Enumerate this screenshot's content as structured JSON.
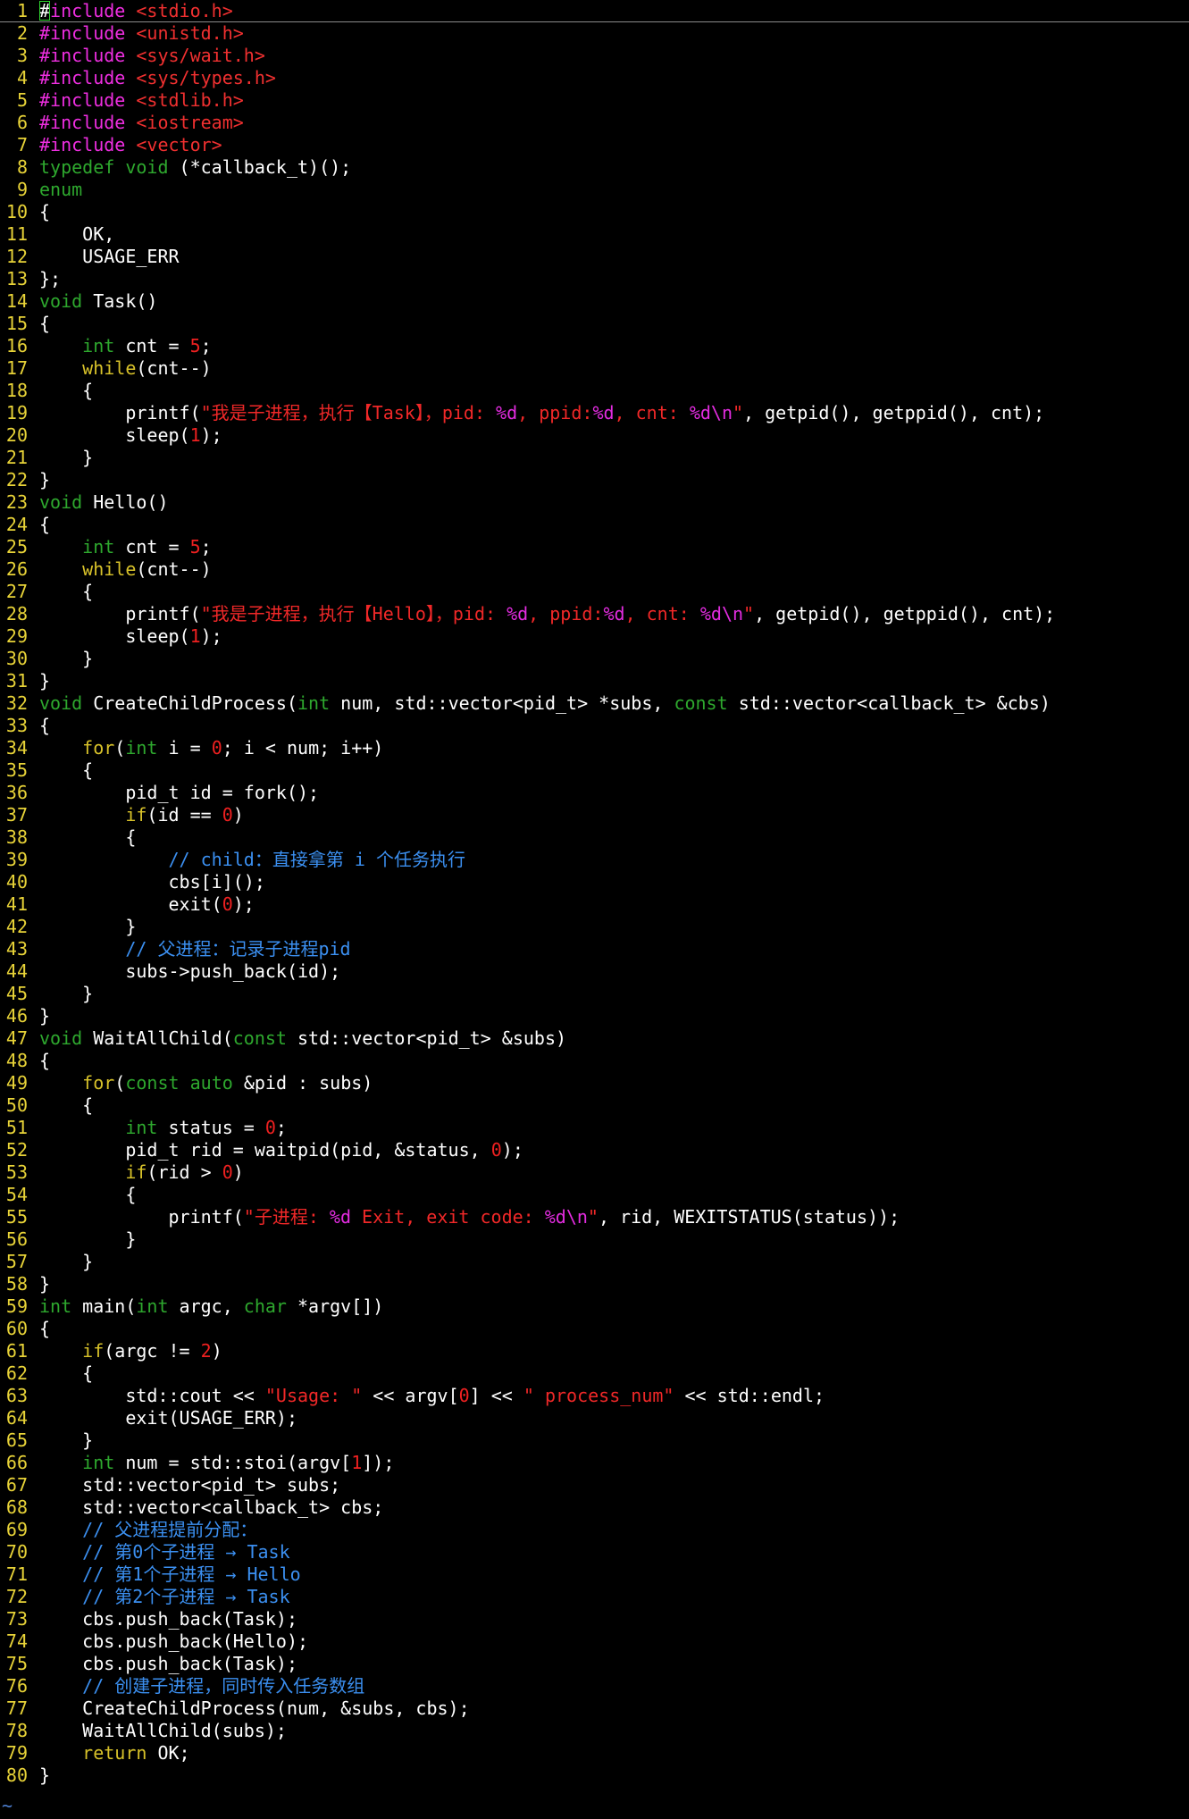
{
  "editor": {
    "colors": {
      "background": "#000000",
      "line_number": "#e8d338",
      "text": "#ffffff",
      "preprocessor": "#ee2ee0",
      "header": "#f03030",
      "type": "#2ea82e",
      "keyword": "#d8c22a",
      "number": "#ee2020",
      "string": "#f02828",
      "format": "#e32ce0",
      "comment": "#3b8ff0",
      "cursor": "#2fd52f"
    },
    "cursor_line": 1,
    "empty_marker": "~",
    "lines": [
      {
        "n": "1",
        "tokens": [
          [
            "t",
            "#"
          ],
          [
            "p",
            "include "
          ],
          [
            "h",
            "<stdio.h>"
          ]
        ]
      },
      {
        "n": "2",
        "tokens": [
          [
            "p",
            "#include "
          ],
          [
            "h",
            "<unistd.h>"
          ]
        ]
      },
      {
        "n": "3",
        "tokens": [
          [
            "p",
            "#include "
          ],
          [
            "h",
            "<sys/wait.h>"
          ]
        ]
      },
      {
        "n": "4",
        "tokens": [
          [
            "p",
            "#include "
          ],
          [
            "h",
            "<sys/types.h>"
          ]
        ]
      },
      {
        "n": "5",
        "tokens": [
          [
            "p",
            "#include "
          ],
          [
            "h",
            "<stdlib.h>"
          ]
        ]
      },
      {
        "n": "6",
        "tokens": [
          [
            "p",
            "#include "
          ],
          [
            "h",
            "<iostream>"
          ]
        ]
      },
      {
        "n": "7",
        "tokens": [
          [
            "p",
            "#include "
          ],
          [
            "h",
            "<vector>"
          ]
        ]
      },
      {
        "n": "8",
        "tokens": [
          [
            "y",
            "typedef"
          ],
          [
            "t",
            " "
          ],
          [
            "y",
            "void"
          ],
          [
            "t",
            " (*callback_t)();"
          ]
        ]
      },
      {
        "n": "9",
        "tokens": [
          [
            "y",
            "enum"
          ]
        ]
      },
      {
        "n": "10",
        "tokens": [
          [
            "t",
            "{"
          ]
        ]
      },
      {
        "n": "11",
        "tokens": [
          [
            "t",
            "    OK,"
          ]
        ]
      },
      {
        "n": "12",
        "tokens": [
          [
            "t",
            "    USAGE_ERR"
          ]
        ]
      },
      {
        "n": "13",
        "tokens": [
          [
            "t",
            "};"
          ]
        ]
      },
      {
        "n": "14",
        "tokens": [
          [
            "y",
            "void"
          ],
          [
            "t",
            " Task()"
          ]
        ]
      },
      {
        "n": "15",
        "tokens": [
          [
            "t",
            "{"
          ]
        ]
      },
      {
        "n": "16",
        "tokens": [
          [
            "t",
            "    "
          ],
          [
            "y",
            "int"
          ],
          [
            "t",
            " cnt = "
          ],
          [
            "d",
            "5"
          ],
          [
            "t",
            ";"
          ]
        ]
      },
      {
        "n": "17",
        "tokens": [
          [
            "t",
            "    "
          ],
          [
            "k",
            "while"
          ],
          [
            "t",
            "(cnt--)"
          ]
        ]
      },
      {
        "n": "18",
        "tokens": [
          [
            "t",
            "    {"
          ]
        ]
      },
      {
        "n": "19",
        "tokens": [
          [
            "t",
            "        printf("
          ],
          [
            "s",
            "\"我是子进程，执行【Task】，pid: "
          ],
          [
            "f",
            "%d"
          ],
          [
            "s",
            ", ppid:"
          ],
          [
            "f",
            "%d"
          ],
          [
            "s",
            ", cnt: "
          ],
          [
            "f",
            "%d\\n"
          ],
          [
            "s",
            "\""
          ],
          [
            "t",
            ", getpid(), getppid(), cnt);"
          ]
        ]
      },
      {
        "n": "20",
        "tokens": [
          [
            "t",
            "        sleep("
          ],
          [
            "d",
            "1"
          ],
          [
            "t",
            ");"
          ]
        ]
      },
      {
        "n": "21",
        "tokens": [
          [
            "t",
            "    }"
          ]
        ]
      },
      {
        "n": "22",
        "tokens": [
          [
            "t",
            "}"
          ]
        ]
      },
      {
        "n": "23",
        "tokens": [
          [
            "y",
            "void"
          ],
          [
            "t",
            " Hello()"
          ]
        ]
      },
      {
        "n": "24",
        "tokens": [
          [
            "t",
            "{"
          ]
        ]
      },
      {
        "n": "25",
        "tokens": [
          [
            "t",
            "    "
          ],
          [
            "y",
            "int"
          ],
          [
            "t",
            " cnt = "
          ],
          [
            "d",
            "5"
          ],
          [
            "t",
            ";"
          ]
        ]
      },
      {
        "n": "26",
        "tokens": [
          [
            "t",
            "    "
          ],
          [
            "k",
            "while"
          ],
          [
            "t",
            "(cnt--)"
          ]
        ]
      },
      {
        "n": "27",
        "tokens": [
          [
            "t",
            "    {"
          ]
        ]
      },
      {
        "n": "28",
        "tokens": [
          [
            "t",
            "        printf("
          ],
          [
            "s",
            "\"我是子进程，执行【Hello】，pid: "
          ],
          [
            "f",
            "%d"
          ],
          [
            "s",
            ", ppid:"
          ],
          [
            "f",
            "%d"
          ],
          [
            "s",
            ", cnt: "
          ],
          [
            "f",
            "%d\\n"
          ],
          [
            "s",
            "\""
          ],
          [
            "t",
            ", getpid(), getppid(), cnt);"
          ]
        ]
      },
      {
        "n": "29",
        "tokens": [
          [
            "t",
            "        sleep("
          ],
          [
            "d",
            "1"
          ],
          [
            "t",
            ");"
          ]
        ]
      },
      {
        "n": "30",
        "tokens": [
          [
            "t",
            "    }"
          ]
        ]
      },
      {
        "n": "31",
        "tokens": [
          [
            "t",
            "}"
          ]
        ]
      },
      {
        "n": "32",
        "tokens": [
          [
            "y",
            "void"
          ],
          [
            "t",
            " CreateChildProcess("
          ],
          [
            "y",
            "int"
          ],
          [
            "t",
            " num, std::vector<pid_t> *subs, "
          ],
          [
            "y",
            "const"
          ],
          [
            "t",
            " std::vector<callback_t> &cbs)"
          ]
        ]
      },
      {
        "n": "33",
        "tokens": [
          [
            "t",
            "{"
          ]
        ]
      },
      {
        "n": "34",
        "tokens": [
          [
            "t",
            "    "
          ],
          [
            "k",
            "for"
          ],
          [
            "t",
            "("
          ],
          [
            "y",
            "int"
          ],
          [
            "t",
            " i = "
          ],
          [
            "d",
            "0"
          ],
          [
            "t",
            "; i < num; i++)"
          ]
        ]
      },
      {
        "n": "35",
        "tokens": [
          [
            "t",
            "    {"
          ]
        ]
      },
      {
        "n": "36",
        "tokens": [
          [
            "t",
            "        pid_t id = fork();"
          ]
        ]
      },
      {
        "n": "37",
        "tokens": [
          [
            "t",
            "        "
          ],
          [
            "k",
            "if"
          ],
          [
            "t",
            "(id == "
          ],
          [
            "d",
            "0"
          ],
          [
            "t",
            ")"
          ]
        ]
      },
      {
        "n": "38",
        "tokens": [
          [
            "t",
            "        {"
          ]
        ]
      },
      {
        "n": "39",
        "tokens": [
          [
            "t",
            "            "
          ],
          [
            "c",
            "// child：直接拿第 i 个任务执行"
          ]
        ]
      },
      {
        "n": "40",
        "tokens": [
          [
            "t",
            "            cbs[i]();"
          ]
        ]
      },
      {
        "n": "41",
        "tokens": [
          [
            "t",
            "            exit("
          ],
          [
            "d",
            "0"
          ],
          [
            "t",
            ");"
          ]
        ]
      },
      {
        "n": "42",
        "tokens": [
          [
            "t",
            "        }"
          ]
        ]
      },
      {
        "n": "43",
        "tokens": [
          [
            "t",
            "        "
          ],
          [
            "c",
            "// 父进程：记录子进程pid"
          ]
        ]
      },
      {
        "n": "44",
        "tokens": [
          [
            "t",
            "        subs->push_back(id);"
          ]
        ]
      },
      {
        "n": "45",
        "tokens": [
          [
            "t",
            "    }"
          ]
        ]
      },
      {
        "n": "46",
        "tokens": [
          [
            "t",
            "}"
          ]
        ]
      },
      {
        "n": "47",
        "tokens": [
          [
            "y",
            "void"
          ],
          [
            "t",
            " WaitAllChild("
          ],
          [
            "y",
            "const"
          ],
          [
            "t",
            " std::vector<pid_t> &subs)"
          ]
        ]
      },
      {
        "n": "48",
        "tokens": [
          [
            "t",
            "{"
          ]
        ]
      },
      {
        "n": "49",
        "tokens": [
          [
            "t",
            "    "
          ],
          [
            "k",
            "for"
          ],
          [
            "t",
            "("
          ],
          [
            "y",
            "const"
          ],
          [
            "t",
            " "
          ],
          [
            "y",
            "auto"
          ],
          [
            "t",
            " &pid : subs)"
          ]
        ]
      },
      {
        "n": "50",
        "tokens": [
          [
            "t",
            "    {"
          ]
        ]
      },
      {
        "n": "51",
        "tokens": [
          [
            "t",
            "        "
          ],
          [
            "y",
            "int"
          ],
          [
            "t",
            " status = "
          ],
          [
            "d",
            "0"
          ],
          [
            "t",
            ";"
          ]
        ]
      },
      {
        "n": "52",
        "tokens": [
          [
            "t",
            "        pid_t rid = waitpid(pid, &status, "
          ],
          [
            "d",
            "0"
          ],
          [
            "t",
            ");"
          ]
        ]
      },
      {
        "n": "53",
        "tokens": [
          [
            "t",
            "        "
          ],
          [
            "k",
            "if"
          ],
          [
            "t",
            "(rid > "
          ],
          [
            "d",
            "0"
          ],
          [
            "t",
            ")"
          ]
        ]
      },
      {
        "n": "54",
        "tokens": [
          [
            "t",
            "        {"
          ]
        ]
      },
      {
        "n": "55",
        "tokens": [
          [
            "t",
            "            printf("
          ],
          [
            "s",
            "\"子进程: "
          ],
          [
            "f",
            "%d"
          ],
          [
            "s",
            " Exit, exit code: "
          ],
          [
            "f",
            "%d\\n"
          ],
          [
            "s",
            "\""
          ],
          [
            "t",
            ", rid, WEXITSTATUS(status));"
          ]
        ]
      },
      {
        "n": "56",
        "tokens": [
          [
            "t",
            "        }"
          ]
        ]
      },
      {
        "n": "57",
        "tokens": [
          [
            "t",
            "    }"
          ]
        ]
      },
      {
        "n": "58",
        "tokens": [
          [
            "t",
            "}"
          ]
        ]
      },
      {
        "n": "59",
        "tokens": [
          [
            "y",
            "int"
          ],
          [
            "t",
            " main("
          ],
          [
            "y",
            "int"
          ],
          [
            "t",
            " argc, "
          ],
          [
            "y",
            "char"
          ],
          [
            "t",
            " *argv[])"
          ]
        ]
      },
      {
        "n": "60",
        "tokens": [
          [
            "t",
            "{"
          ]
        ]
      },
      {
        "n": "61",
        "tokens": [
          [
            "t",
            "    "
          ],
          [
            "k",
            "if"
          ],
          [
            "t",
            "(argc != "
          ],
          [
            "d",
            "2"
          ],
          [
            "t",
            ")"
          ]
        ]
      },
      {
        "n": "62",
        "tokens": [
          [
            "t",
            "    {"
          ]
        ]
      },
      {
        "n": "63",
        "tokens": [
          [
            "t",
            "        std::cout << "
          ],
          [
            "s",
            "\"Usage: \""
          ],
          [
            "t",
            " << argv["
          ],
          [
            "d",
            "0"
          ],
          [
            "t",
            "] << "
          ],
          [
            "s",
            "\" process_num\""
          ],
          [
            "t",
            " << std::endl;"
          ]
        ]
      },
      {
        "n": "64",
        "tokens": [
          [
            "t",
            "        exit(USAGE_ERR);"
          ]
        ]
      },
      {
        "n": "65",
        "tokens": [
          [
            "t",
            "    }"
          ]
        ]
      },
      {
        "n": "66",
        "tokens": [
          [
            "t",
            "    "
          ],
          [
            "y",
            "int"
          ],
          [
            "t",
            " num = std::stoi(argv["
          ],
          [
            "d",
            "1"
          ],
          [
            "t",
            "]);"
          ]
        ]
      },
      {
        "n": "67",
        "tokens": [
          [
            "t",
            "    std::vector<pid_t> subs;"
          ]
        ]
      },
      {
        "n": "68",
        "tokens": [
          [
            "t",
            "    std::vector<callback_t> cbs;"
          ]
        ]
      },
      {
        "n": "69",
        "tokens": [
          [
            "t",
            "    "
          ],
          [
            "c",
            "// 父进程提前分配："
          ]
        ]
      },
      {
        "n": "70",
        "tokens": [
          [
            "t",
            "    "
          ],
          [
            "c",
            "// 第0个子进程 → Task"
          ]
        ]
      },
      {
        "n": "71",
        "tokens": [
          [
            "t",
            "    "
          ],
          [
            "c",
            "// 第1个子进程 → Hello"
          ]
        ]
      },
      {
        "n": "72",
        "tokens": [
          [
            "t",
            "    "
          ],
          [
            "c",
            "// 第2个子进程 → Task"
          ]
        ]
      },
      {
        "n": "73",
        "tokens": [
          [
            "t",
            "    cbs.push_back(Task);"
          ]
        ]
      },
      {
        "n": "74",
        "tokens": [
          [
            "t",
            "    cbs.push_back(Hello);"
          ]
        ]
      },
      {
        "n": "75",
        "tokens": [
          [
            "t",
            "    cbs.push_back(Task);"
          ]
        ]
      },
      {
        "n": "76",
        "tokens": [
          [
            "t",
            "    "
          ],
          [
            "c",
            "// 创建子进程，同时传入任务数组"
          ]
        ]
      },
      {
        "n": "77",
        "tokens": [
          [
            "t",
            "    CreateChildProcess(num, &subs, cbs);"
          ]
        ]
      },
      {
        "n": "78",
        "tokens": [
          [
            "t",
            "    WaitAllChild(subs);"
          ]
        ]
      },
      {
        "n": "79",
        "tokens": [
          [
            "t",
            "    "
          ],
          [
            "k",
            "return"
          ],
          [
            "t",
            " OK;"
          ]
        ]
      },
      {
        "n": "80",
        "tokens": [
          [
            "t",
            "}"
          ]
        ]
      }
    ]
  }
}
